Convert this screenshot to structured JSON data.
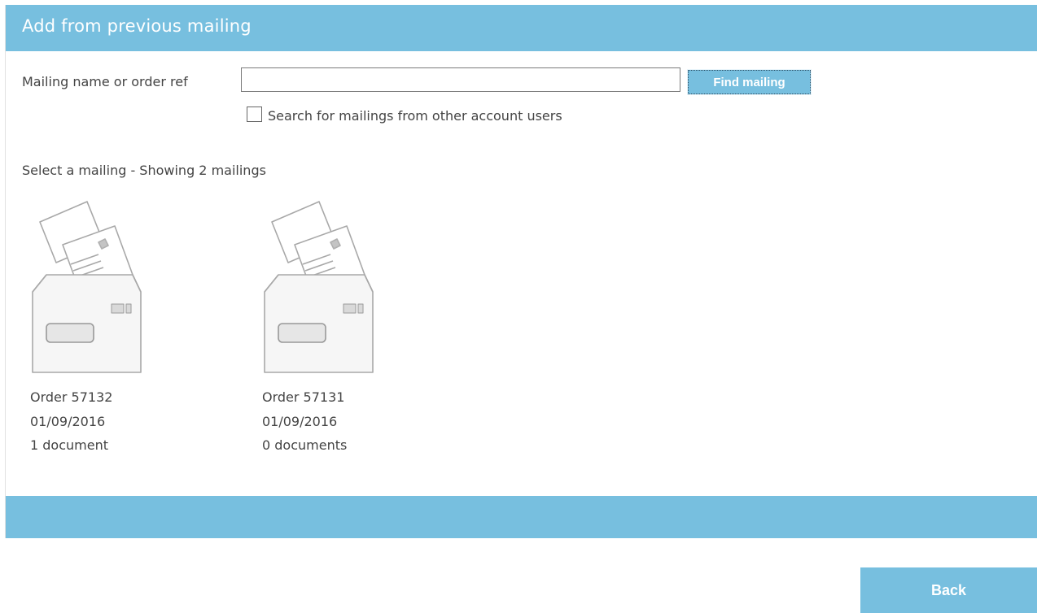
{
  "header": {
    "title": "Add from previous mailing"
  },
  "search": {
    "label": "Mailing name or order ref",
    "value": "",
    "button_label": "Find mailing",
    "checkbox_label": "Search for mailings from other account users",
    "checkbox_checked": false
  },
  "results": {
    "heading": "Select a mailing - Showing 2 mailings",
    "mailings": [
      {
        "name": "Order 57132",
        "date": "01/09/2016",
        "documents": "1 document",
        "icon": "envelope-with-letters-icon"
      },
      {
        "name": "Order 57131",
        "date": "01/09/2016",
        "documents": "0 documents",
        "icon": "envelope-with-letters-icon"
      }
    ]
  },
  "footer": {
    "back_label": "Back"
  },
  "colors": {
    "accent": "#77bfdf",
    "text": "#444444",
    "icon_stroke": "#a8a8a8"
  }
}
